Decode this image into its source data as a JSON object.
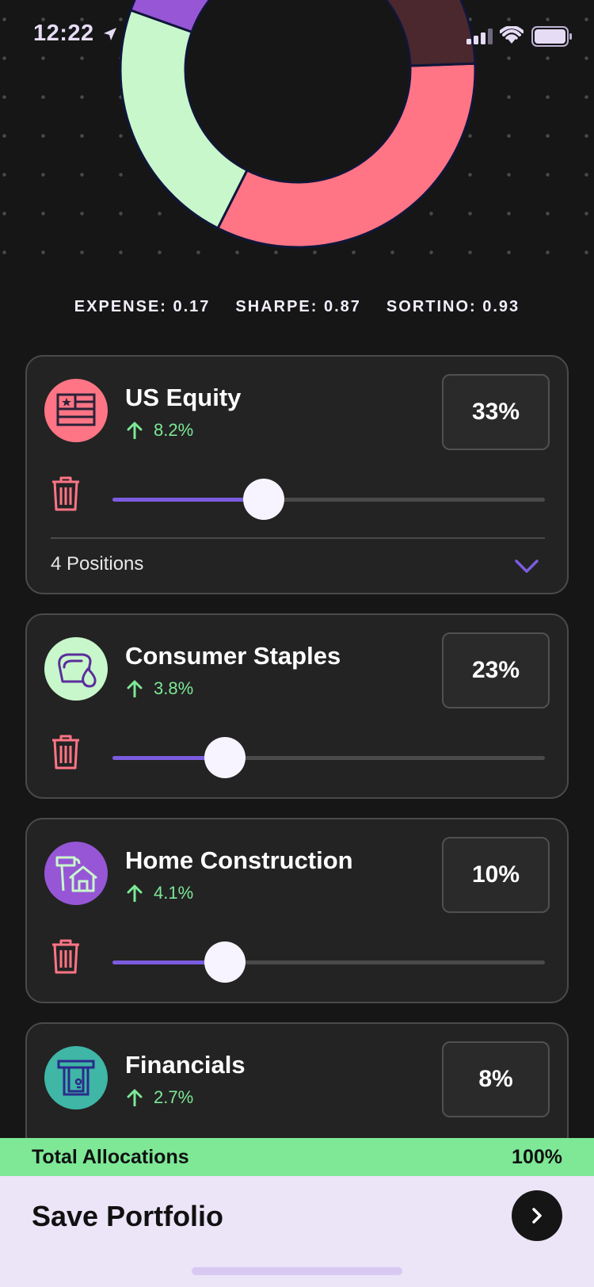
{
  "status_bar": {
    "time": "12:22"
  },
  "allocation_chart": {
    "segments": [
      {
        "value": 33,
        "color": "#ff7585"
      },
      {
        "value": 23,
        "color": "#c8f7cb"
      },
      {
        "value": 10,
        "color": "#9656d6"
      },
      {
        "value": 1,
        "color": "#3fb6a6"
      },
      {
        "value": 8,
        "color": "#223a35"
      },
      {
        "value": 12,
        "color": "#2b2238"
      },
      {
        "value": 13,
        "color": "#4b272e"
      }
    ]
  },
  "metrics": {
    "expense": "EXPENSE: 0.17",
    "sharpe": "SHARPE: 0.87",
    "sortino": "SORTINO: 0.93"
  },
  "allocations": [
    {
      "name": "US Equity",
      "change": "8.2%",
      "percent_label": "33%",
      "percent": 33,
      "slider_fraction": 0.35,
      "icon": "flag-icon",
      "icon_color": "#ff7585",
      "positions": "4 Positions"
    },
    {
      "name": "Consumer Staples",
      "change": "3.8%",
      "percent_label": "23%",
      "percent": 23,
      "slider_fraction": 0.26,
      "icon": "bread-icon",
      "icon_color": "#c8f7cb"
    },
    {
      "name": "Home Construction",
      "change": "4.1%",
      "percent_label": "10%",
      "percent": 10,
      "slider_fraction": 0.26,
      "icon": "hammer-house-icon",
      "icon_color": "#9656d6"
    },
    {
      "name": "Financials",
      "change": "2.7%",
      "percent_label": "8%",
      "percent": 8,
      "icon": "atm-icon",
      "icon_color": "#3fb6a6"
    }
  ],
  "total": {
    "label": "Total Allocations",
    "value": "100%"
  },
  "save": {
    "label": "Save Portfolio"
  },
  "colors": {
    "accent": "#7b5ce0",
    "positive": "#7de896",
    "total_bar": "#7ee896",
    "save_bar": "#ece4f7"
  }
}
